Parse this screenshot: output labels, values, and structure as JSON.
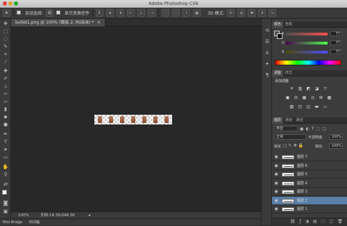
{
  "app": {
    "title": "Adobe Photoshop CS6"
  },
  "options_bar": {
    "auto_select_label": "自动选择:",
    "auto_select_value": "组",
    "show_transform_label": "显示变换控件",
    "mode_3d_label": "3D 模式:"
  },
  "document": {
    "tab_title": "bullet1.png @ 100% (图层 2, RGB/8) *",
    "zoom": "100%",
    "doc_size": "文档:19.7K/248.3K"
  },
  "bottom_tabs": [
    "Mini Bridge",
    "时间轴"
  ],
  "color_panel": {
    "tabs": [
      "颜色",
      "色板"
    ],
    "channels": [
      {
        "label": "R",
        "value": "77"
      },
      {
        "label": "G",
        "value": "77"
      },
      {
        "label": "B",
        "value": "77"
      }
    ]
  },
  "adjustments_panel": {
    "tabs": [
      "调整",
      "样式"
    ],
    "heading": "添加调整",
    "icons_row1": [
      "☀",
      "▥",
      "◩",
      "◪",
      "▽"
    ],
    "icons_row2": [
      "▣",
      "⚖",
      "▦",
      "◎",
      "⊞",
      "▩"
    ],
    "icons_row3": [
      "▨",
      "◰",
      "◱",
      "▬",
      "▭"
    ]
  },
  "layers_panel": {
    "tabs": [
      "图层",
      "通道",
      "路径"
    ],
    "kind_label": "类型",
    "blend_mode": "正常",
    "opacity_label": "不透明度:",
    "opacity_value": "100%",
    "lock_label": "锁定:",
    "fill_label": "填充:",
    "fill_value": "100%",
    "layers": [
      {
        "name": "图层 7",
        "selected": false
      },
      {
        "name": "图层 6",
        "selected": false
      },
      {
        "name": "图层 5",
        "selected": false
      },
      {
        "name": "图层 4",
        "selected": false
      },
      {
        "name": "图层 3",
        "selected": false
      },
      {
        "name": "图层 2",
        "selected": true
      },
      {
        "name": "图层 1",
        "selected": false
      }
    ]
  },
  "colors": {
    "accent_selected_layer": "#5a7ea8",
    "canvas_bg": "#282828",
    "panel_bg": "#3c3c3c"
  }
}
